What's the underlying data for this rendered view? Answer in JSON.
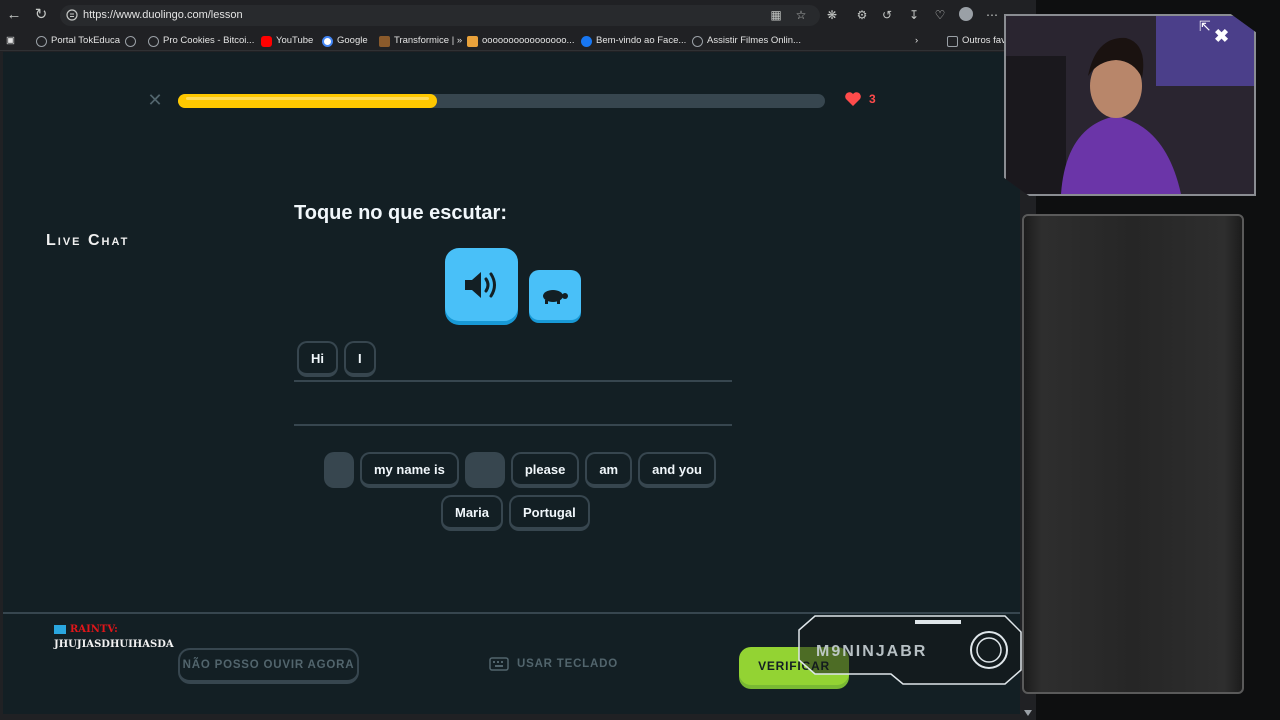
{
  "browser": {
    "url": "https://www.duolingo.com/lesson",
    "bookmarks": [
      {
        "label": "Portal TokEduca",
        "color": "#9aa0a6"
      },
      {
        "label": "Pro Cookies - Bitcoi...",
        "color": "#9aa0a6"
      },
      {
        "label": "YouTube",
        "color": "#ff0000"
      },
      {
        "label": "Google",
        "color": "#4285f4"
      },
      {
        "label": "Transformice | »",
        "color": "#8a5a2b"
      },
      {
        "label": "oooooooooooooooo...",
        "color": "#e9a23b"
      },
      {
        "label": "Bem-vindo ao Face...",
        "color": "#1877f2"
      },
      {
        "label": "Assistir Filmes Onlin...",
        "color": "#9aa0a6"
      },
      {
        "label": "Outros fav",
        "color": "#9aa0a6"
      }
    ]
  },
  "lesson": {
    "progress_percent": 40,
    "hearts": "3",
    "prompt": "Toque no que escutar:",
    "answer_tiles": [
      "Hi",
      "I"
    ],
    "word_bank_row1": [
      "",
      "my name is",
      "",
      "please",
      "am",
      "and you"
    ],
    "word_bank_row2": [
      "Maria",
      "Portugal"
    ],
    "cant_listen_label": "NÃO POSSO OUVIR AGORA",
    "keyboard_label": "USAR TECLADO",
    "verify_label": "VERIFICAR"
  },
  "overlay": {
    "chat_title": "Live Chat",
    "chat_user": "RAINTV:",
    "chat_message": "JHUJIASDHUIHASDA",
    "watermark": "M9NINJABR"
  },
  "colors": {
    "page_bg": "#131f24",
    "progress": "#ffc800",
    "heart": "#ff4b4b",
    "speaker": "#49c0f8",
    "verify": "#93d333"
  }
}
